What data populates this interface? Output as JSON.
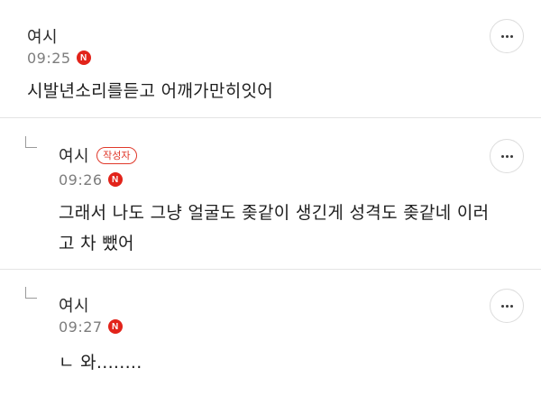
{
  "comments": [
    {
      "author": "여시",
      "time": "09:25",
      "new_mark": "N",
      "is_reply": false,
      "writer_badge": "",
      "body_lines": [
        "시발년소리를듣고 어깨가만히잇어"
      ],
      "more_icon": "more-horizontal-icon"
    },
    {
      "author": "여시",
      "time": "09:26",
      "new_mark": "N",
      "is_reply": true,
      "writer_badge": "작성자",
      "body_lines": [
        "그래서 나도 그냥 얼굴도 좆같이 생긴게 성격도 좆같네 이러",
        "고 차 뺐어"
      ],
      "more_icon": "more-horizontal-icon"
    },
    {
      "author": "여시",
      "time": "09:27",
      "new_mark": "N",
      "is_reply": true,
      "writer_badge": "",
      "body_lines": [
        "ㄴ 와........"
      ],
      "more_icon": "more-horizontal-icon"
    }
  ],
  "colors": {
    "new_badge": "#e2231a",
    "writer_badge": "#e0392b",
    "divider": "#e4e4e4",
    "time": "#7d7d7d"
  }
}
